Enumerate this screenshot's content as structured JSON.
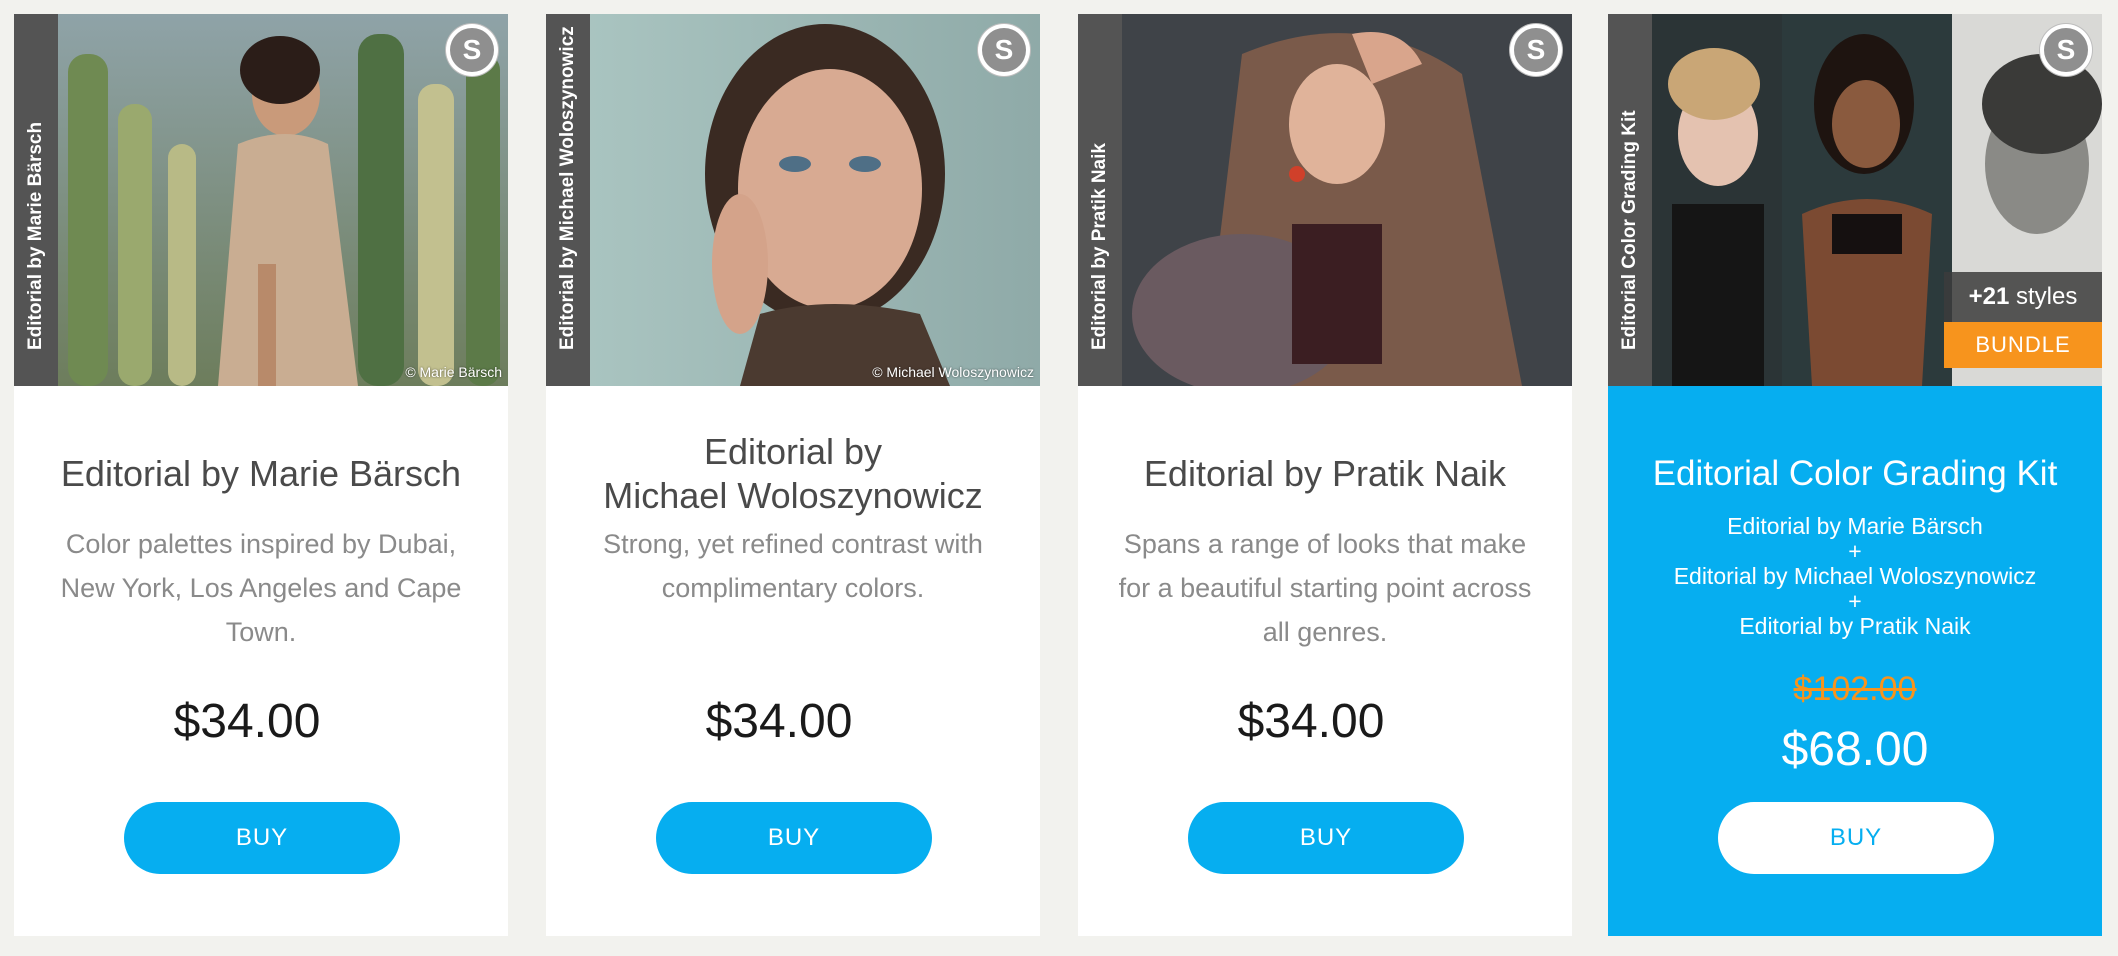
{
  "colors": {
    "accent": "#06aef0",
    "bundle_tag": "#f7941d",
    "spine": "#545454"
  },
  "cards": [
    {
      "spine_label": "Editorial by Marie Bärsch",
      "badge_letter": "S",
      "photo_credit": "© Marie Bärsch",
      "title": "Editorial by Marie Bärsch",
      "description": "Color palettes inspired by Dubai, New York, Los Angeles and Cape Town.",
      "price": "$34.00",
      "buy_label": "BUY"
    },
    {
      "spine_label": "Editorial by Michael Woloszynowicz",
      "badge_letter": "S",
      "photo_credit": "© Michael Woloszynowicz",
      "title_line1": "Editorial by",
      "title_line2": "Michael Woloszynowicz",
      "description": "Strong, yet refined contrast with complimentary colors.",
      "price": "$34.00",
      "buy_label": "BUY"
    },
    {
      "spine_label": "Editorial by Pratik Naik",
      "badge_letter": "S",
      "title": "Editorial by Pratik Naik",
      "description": "Spans a range of looks that make for a beautiful starting point across all genres.",
      "price": "$34.00",
      "buy_label": "BUY"
    },
    {
      "spine_label": "Editorial Color Grading Kit",
      "badge_letter": "S",
      "styles_count": "+21",
      "styles_word": "styles",
      "bundle_label": "BUNDLE",
      "title": "Editorial Color Grading Kit",
      "includes": [
        "Editorial by Marie Bärsch",
        "+",
        "Editorial by Michael Woloszynowicz",
        "+",
        "Editorial by Pratik Naik"
      ],
      "old_price": "$102.00",
      "price": "$68.00",
      "buy_label": "BUY"
    }
  ]
}
